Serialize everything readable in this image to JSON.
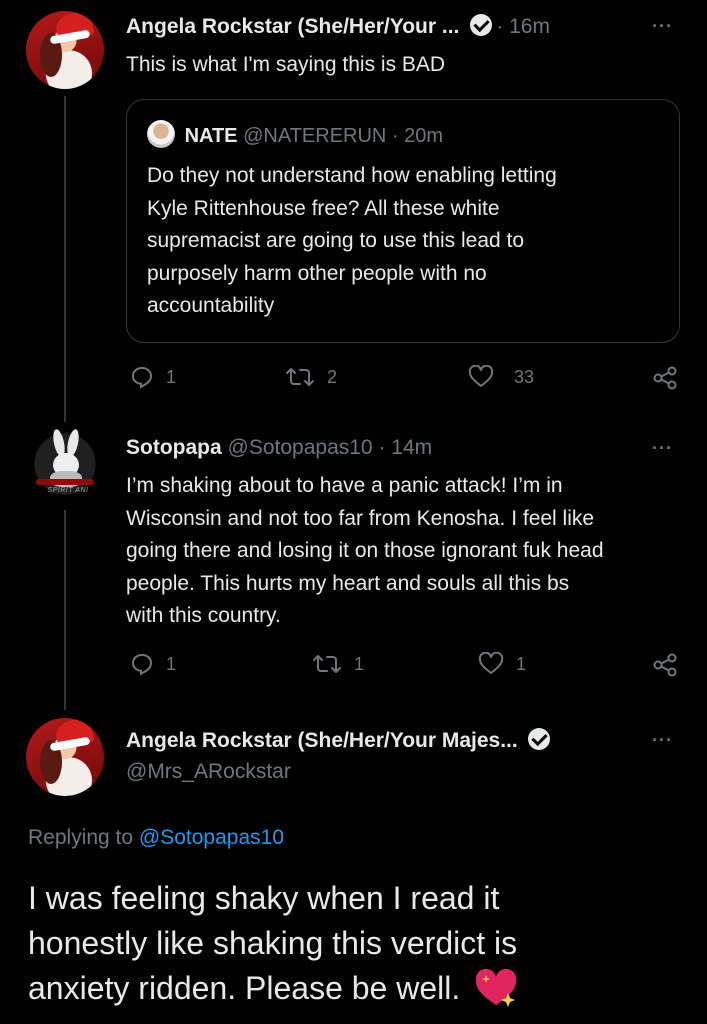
{
  "tweet1": {
    "name": "Angela Rockstar (She/Her/Your ...",
    "time": "· 16m",
    "text": "This is what I'm saying this is BAD",
    "more": "···",
    "quote": {
      "name": "NATE",
      "handle": "@NATERERUN",
      "time": "· 20m",
      "text_lines": [
        "Do they not understand how enabling  letting",
        "Kyle Rittenhouse free? All these white",
        "supremacist are going to use this lead to",
        "purposely harm other people with no",
        "accountability"
      ]
    },
    "actions": {
      "replies": "1",
      "retweets": "2",
      "likes": "33"
    }
  },
  "tweet2": {
    "name": "Sotopapa",
    "handle": "@Sotopapas10",
    "time": "· 14m",
    "more": "···",
    "avatar_text": "SPIRIT ANI",
    "text_lines": [
      "I’m shaking about to have a panic attack! I’m in",
      "Wisconsin and not too far from Kenosha. I feel like",
      "going there and losing it on those ignorant fuk head",
      "people. This hurts my heart and souls all this bs",
      "with this country."
    ],
    "actions": {
      "replies": "1",
      "retweets": "1",
      "likes": "1"
    }
  },
  "tweet3": {
    "name": "Angela Rockstar (She/Her/Your Majes...",
    "handle": "@Mrs_ARockstar",
    "more": "···",
    "replying_prefix": "Replying to",
    "replying_handle": "@Sotopapas10",
    "text_lines": [
      "I was feeling shaky when I read it",
      "honestly like shaking this verdict is",
      "anxiety ridden. Please be well."
    ]
  },
  "colors": {
    "background": "#000000",
    "text": "#e7e9ea",
    "muted": "#71767b",
    "link": "#1d9bf0",
    "border": "#333639"
  }
}
